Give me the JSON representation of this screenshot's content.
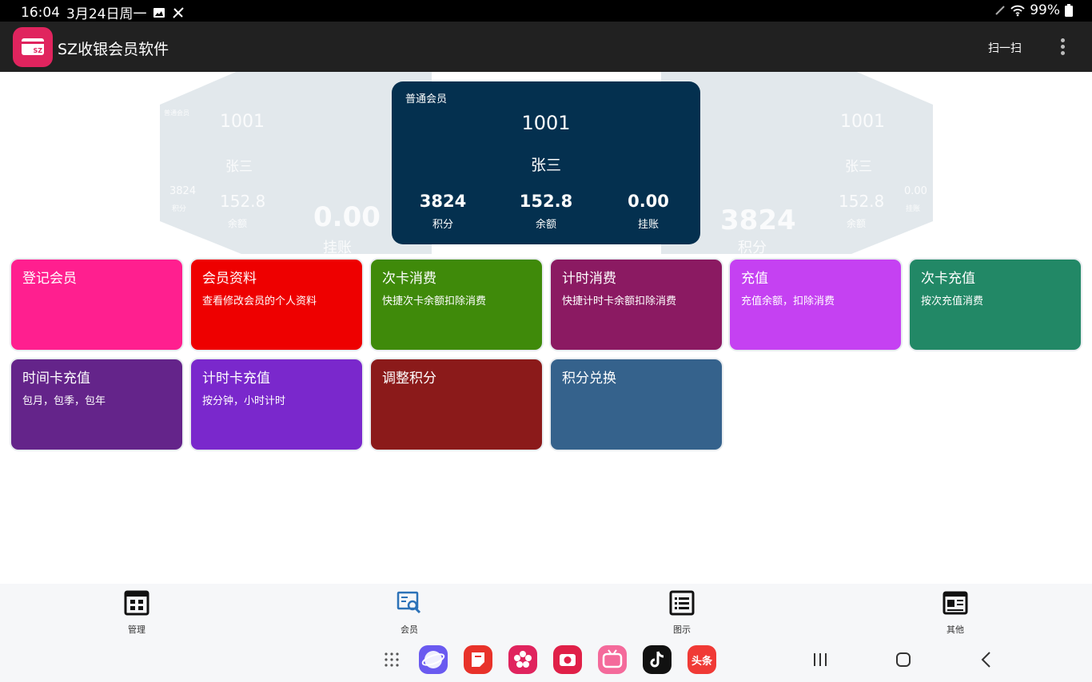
{
  "status_bar": {
    "time": "16:04",
    "date": "3月24日周一",
    "battery": "99%",
    "icons": [
      "gallery-icon",
      "tools-icon",
      "pen-icon",
      "wifi-icon",
      "battery-icon"
    ]
  },
  "app_bar": {
    "title": "SZ收银会员软件",
    "logo_text": "SZ",
    "scan_label": "扫一扫",
    "more_icon": "more-vert-icon"
  },
  "member_card": {
    "level": "普通会员",
    "id": "1001",
    "name": "张三",
    "stats": [
      {
        "value": "3824",
        "label": "积分"
      },
      {
        "value": "152.8",
        "label": "余额"
      },
      {
        "value": "0.00",
        "label": "挂账"
      }
    ]
  },
  "ghost_cards": {
    "left": {
      "level": "普通会员",
      "id": "1001",
      "name": "张三",
      "points": "3824",
      "points_label": "积分",
      "balance": "152.8",
      "balance_label": "余额",
      "debt": "0.00",
      "debt_label": "挂账"
    },
    "right": {
      "id": "1001",
      "name": "张三",
      "points": "3824",
      "points_label": "积分",
      "balance": "152.8",
      "balance_label": "余额",
      "debt": "0.00",
      "debt_label": "挂账"
    }
  },
  "tiles": [
    {
      "title": "登记会员",
      "subtitle": "",
      "color": "#ff1f8f"
    },
    {
      "title": "会员资料",
      "subtitle": "查看修改会员的个人资料",
      "color": "#ee0000"
    },
    {
      "title": "次卡消费",
      "subtitle": "快捷次卡余额扣除消费",
      "color": "#3f8a0a"
    },
    {
      "title": "计时消费",
      "subtitle": "快捷计时卡余额扣除消费",
      "color": "#8b1a62"
    },
    {
      "title": "充值",
      "subtitle": "充值余额，扣除消费",
      "color": "#c541f2"
    },
    {
      "title": "次卡充值",
      "subtitle": "按次充值消费",
      "color": "#228866"
    },
    {
      "title": "时间卡充值",
      "subtitle": "包月，包季，包年",
      "color": "#64248a"
    },
    {
      "title": "计时卡充值",
      "subtitle": "按分钟，小时计时",
      "color": "#7a28cc"
    },
    {
      "title": "调整积分",
      "subtitle": "",
      "color": "#8b1a1a"
    },
    {
      "title": "积分兑换",
      "subtitle": "",
      "color": "#35628c"
    }
  ],
  "bottom_nav": [
    {
      "label": "管理",
      "icon": "grid-manage-icon"
    },
    {
      "label": "会员",
      "icon": "member-search-icon"
    },
    {
      "label": "图示",
      "icon": "list-chart-icon"
    },
    {
      "label": "其他",
      "icon": "profile-card-icon"
    }
  ],
  "dock_apps": [
    {
      "name": "samsung-internet-app",
      "color": "#6a5af0"
    },
    {
      "name": "notes-app",
      "color": "#e8322a"
    },
    {
      "name": "flower-app",
      "color": "#e0245e"
    },
    {
      "name": "camera-app",
      "color": "#e02048"
    },
    {
      "name": "bilibili-app",
      "color": "#f46a9b"
    },
    {
      "name": "tiktok-app",
      "color": "#111111"
    },
    {
      "name": "toutiao-app",
      "color": "#f03a36",
      "text": "头条"
    }
  ]
}
